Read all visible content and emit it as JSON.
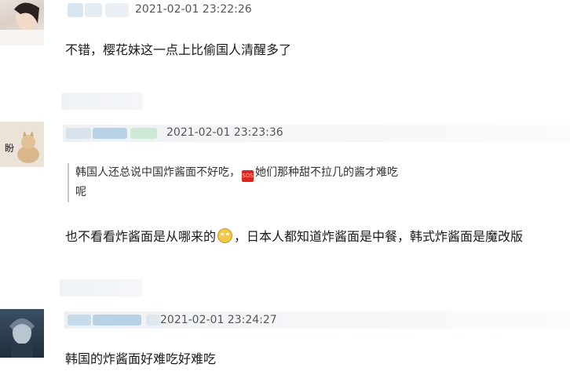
{
  "comments": [
    {
      "timestamp": "2021-02-01 23:22:26",
      "text": "不错，樱花妹这一点上比偷国人清醒多了"
    },
    {
      "timestamp": "2021-02-01 23:23:36",
      "avatar_text": "盼",
      "quote_line1_a": "韩国人还总说中国炸酱面不好吃，",
      "quote_emoji_label": "SOS",
      "quote_line1_b": "她们那种甜不拉几的酱才难吃",
      "quote_line2": "呢",
      "text_a": "也不看看炸酱面是从哪来的",
      "text_b": "，日本人都知道炸酱面是中餐，韩式炸酱面是魔改版"
    },
    {
      "timestamp": "2021-02-01 23:24:27",
      "text": "韩国的炸酱面好难吃好难吃"
    }
  ],
  "colors": {
    "namebar": "#eef1f4",
    "blur_blue": "#b8d3e6",
    "blur_green": "#cfe8d4"
  }
}
